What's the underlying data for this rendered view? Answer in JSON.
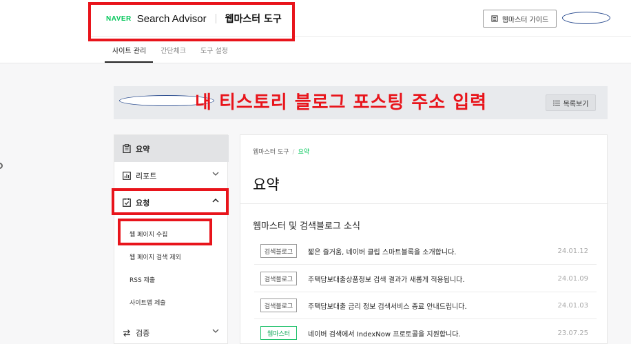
{
  "header": {
    "brand_logo": "NAVER",
    "brand_product": "Search Advisor",
    "tool_name": "웹마스터 도구",
    "guide_button": "웹마스터 가이드",
    "tabs": [
      {
        "label": "사이트 관리",
        "active": true
      },
      {
        "label": "간단체크",
        "active": false
      },
      {
        "label": "도구 설정",
        "active": false
      }
    ]
  },
  "site_bar": {
    "annotation": "내 티스토리 블로그 포스팅 주소 입력",
    "list_button": "목록보기"
  },
  "sidebar": {
    "items": [
      {
        "label": "요약",
        "icon": "clipboard-icon",
        "selected": true
      },
      {
        "label": "리포트",
        "icon": "bar-chart-icon",
        "expanded": false
      },
      {
        "label": "요청",
        "icon": "check-square-icon",
        "expanded": true
      },
      {
        "label": "검증",
        "icon": "swap-arrows-icon",
        "expanded": false
      }
    ],
    "sub_items": [
      {
        "label": "웹 페이지 수집"
      },
      {
        "label": "웹 페이지 검색 제외"
      },
      {
        "label": "RSS 제출"
      },
      {
        "label": "사이트맵 제출"
      }
    ]
  },
  "main": {
    "breadcrumb": {
      "root": "웹마스터 도구",
      "separator": "/",
      "current": "요약"
    },
    "title": "요약",
    "news_title": "웹마스터 및 검색블로그 소식",
    "news": [
      {
        "badge": "검색블로그",
        "text": "짧은 즐거움, 네이버 클립 스마트블록을 소개합니다.",
        "date": "24.01.12"
      },
      {
        "badge": "검색블로그",
        "text": "주택담보대출상품정보 검색 결과가 새롭게 적용됩니다.",
        "date": "24.01.09"
      },
      {
        "badge": "검색블로그",
        "text": "주택담보대출 금리 정보 검색서비스 종료 안내드립니다.",
        "date": "24.01.03"
      },
      {
        "badge": "웹마스터",
        "text": "네이버 검색에서 IndexNow 프로토콜을 지원합니다.",
        "date": "23.07.25"
      }
    ]
  },
  "colors": {
    "accent": "#03c75a",
    "highlight": "#e8141b",
    "selected_bg": "#e2e3e5"
  }
}
